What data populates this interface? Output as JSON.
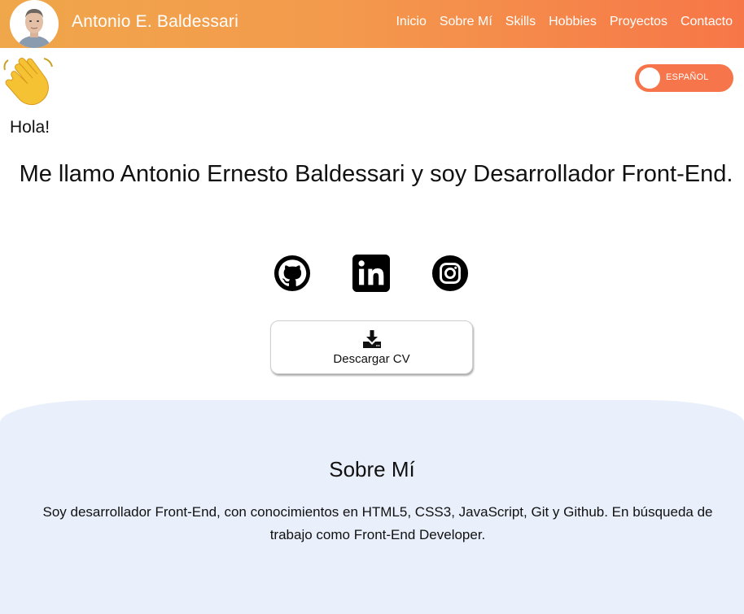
{
  "header": {
    "brand": "Antonio E. Baldessari",
    "nav": [
      "Inicio",
      "Sobre Mí",
      "Skills",
      "Hobbies",
      "Proyectos",
      "Contacto"
    ]
  },
  "language_toggle": {
    "label": "ESPAÑOL"
  },
  "hero": {
    "greeting": "Hola!",
    "intro": "Me llamo Antonio Ernesto Baldessari y soy Desarrollador Front-End.",
    "socials": [
      "github-icon",
      "linkedin-icon",
      "instagram-icon"
    ],
    "cv_button": "Descargar CV"
  },
  "about": {
    "title": "Sobre Mí",
    "text": "Soy desarrollador Front-End, con conocimientos en HTML5, CSS3, JavaScript, Git y Github. En búsqueda de trabajo como Front-End Developer."
  },
  "colors": {
    "navbar_start": "#f0a64a",
    "navbar_end": "#f77648",
    "toggle": "#f7754a",
    "about_bg": "#e9f0fb"
  }
}
